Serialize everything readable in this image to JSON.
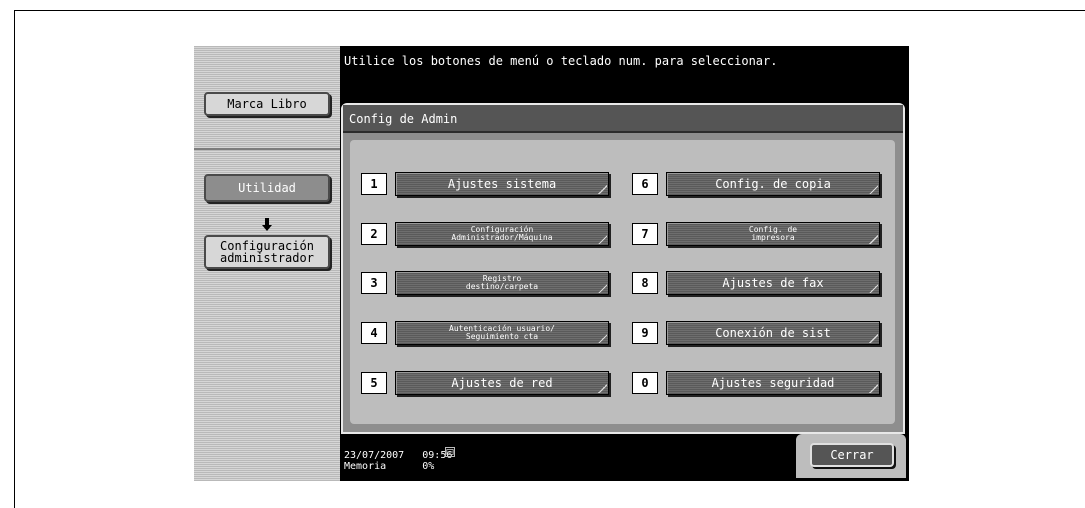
{
  "message": "Utilice los botones de menú o teclado num. para seleccionar.",
  "sidebar": {
    "bookmark_label": "Marca Libro",
    "utility_label": "Utilidad",
    "admin_config_label": "Configuración\nadministrador"
  },
  "panel": {
    "title": "Config de Admin",
    "items": [
      {
        "num": "1",
        "label": "Ajustes sistema"
      },
      {
        "num": "2",
        "label": "Configuración\nAdministrador/Máquina"
      },
      {
        "num": "3",
        "label": "Registro\ndestino/carpeta"
      },
      {
        "num": "4",
        "label": "Autenticación usuario/\nSeguimiento cta"
      },
      {
        "num": "5",
        "label": "Ajustes de red"
      },
      {
        "num": "6",
        "label": "Config. de copia"
      },
      {
        "num": "7",
        "label": "Config. de\nimpresora"
      },
      {
        "num": "8",
        "label": "Ajustes de fax"
      },
      {
        "num": "9",
        "label": "Conexión de sist"
      },
      {
        "num": "0",
        "label": "Ajustes seguridad"
      }
    ]
  },
  "status": {
    "datetime": "23/07/2007   09:56",
    "memory": "Memoria      0%",
    "icon": "printer-status-icon"
  },
  "close_label": "Cerrar"
}
